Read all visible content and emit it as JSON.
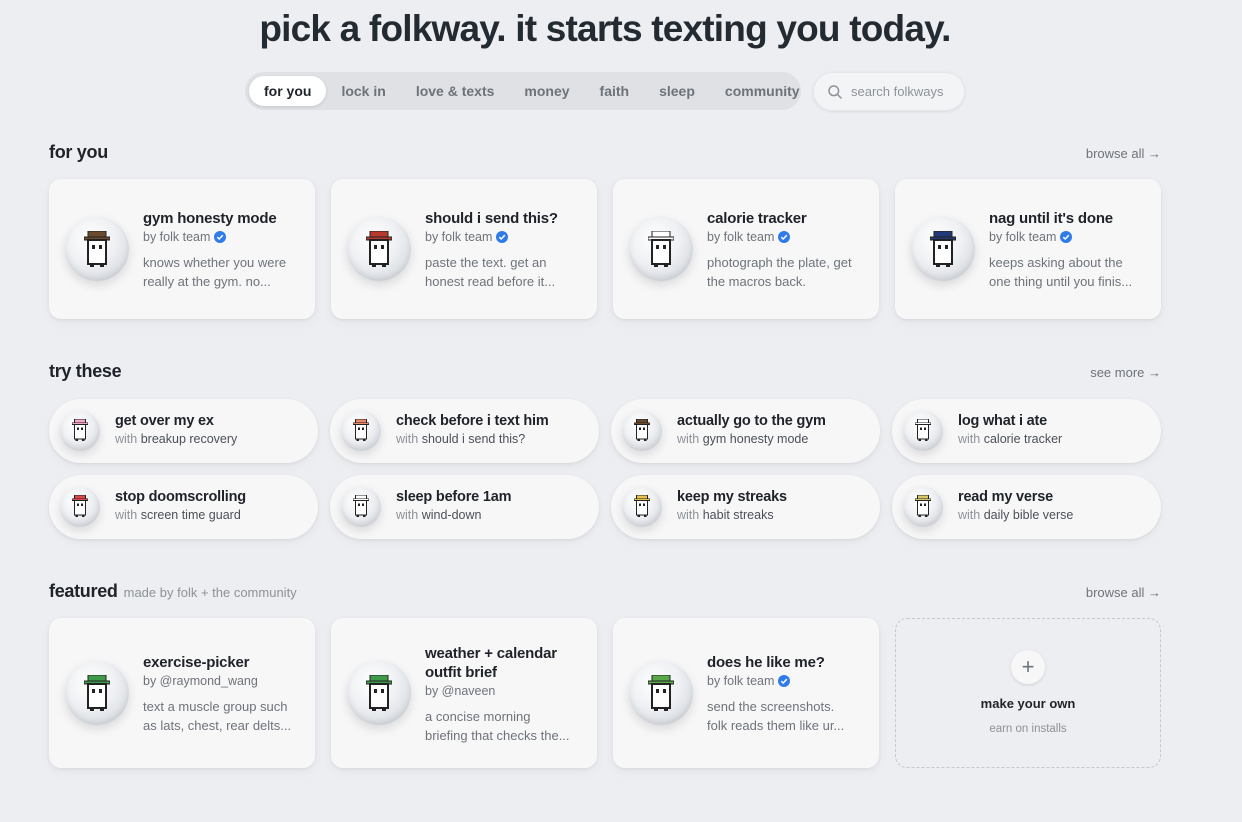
{
  "hero": {
    "title": "pick a folkway. it starts texting you today."
  },
  "tabs": [
    {
      "label": "for you",
      "active": true
    },
    {
      "label": "lock in"
    },
    {
      "label": "love & texts"
    },
    {
      "label": "money"
    },
    {
      "label": "faith"
    },
    {
      "label": "sleep"
    },
    {
      "label": "community"
    }
  ],
  "search": {
    "placeholder": "search folkways",
    "icon": "search-icon"
  },
  "sections": {
    "for_you": {
      "title": "for you",
      "link": "browse all →",
      "cards": [
        {
          "title": "gym honesty mode",
          "author": "by folk team",
          "verified": true,
          "desc1": "knows whether you were",
          "desc2": "really at the gym. no...",
          "hat": "#6b4a2f"
        },
        {
          "title": "should i send this?",
          "author": "by folk team",
          "verified": true,
          "desc1": "paste the text. get an",
          "desc2": "honest read before it...",
          "hat": "#b83a2e"
        },
        {
          "title": "calorie tracker",
          "author": "by folk team",
          "verified": true,
          "desc1": "photograph the plate, get",
          "desc2": "the macros back.",
          "hat": "#ffffff"
        },
        {
          "title": "nag until it's done",
          "author": "by folk team",
          "verified": true,
          "desc1": "keeps asking about the",
          "desc2": "one thing until you finis...",
          "hat": "#233a7a"
        }
      ]
    },
    "try_these": {
      "title": "try these",
      "link": "see more →",
      "with_prefix": "with",
      "pills": [
        {
          "title": "get over my ex",
          "with": "breakup recovery",
          "color": "#f2a6c8"
        },
        {
          "title": "check before i text him",
          "with": "should i send this?",
          "color": "#e88a6a"
        },
        {
          "title": "actually go to the gym",
          "with": "gym honesty mode",
          "color": "#6b4a2f"
        },
        {
          "title": "log what i ate",
          "with": "calorie tracker",
          "color": "#ffffff"
        },
        {
          "title": "stop doomscrolling",
          "with": "screen time guard",
          "color": "#d94a4a"
        },
        {
          "title": "sleep before 1am",
          "with": "wind-down",
          "color": "#ffffff"
        },
        {
          "title": "keep my streaks",
          "with": "habit streaks",
          "color": "#e8c24a"
        },
        {
          "title": "read my verse",
          "with": "daily bible verse",
          "color": "#d9c86a"
        }
      ]
    },
    "featured": {
      "title": "featured",
      "subtitle": "made by folk + the community",
      "link": "browse all →",
      "cards": [
        {
          "title": "exercise-picker",
          "author": "by @raymond_wang",
          "verified": false,
          "desc1": "text a muscle group such",
          "desc2": "as lats, chest, rear delts...",
          "hat": "#3f9a4a"
        },
        {
          "title": "weather + calendar outfit brief",
          "author": "by @naveen",
          "verified": false,
          "desc1": "a concise morning",
          "desc2": "briefing that checks the...",
          "hat": "#3f9a4a"
        },
        {
          "title": "does he like me?",
          "author": "by folk team",
          "verified": true,
          "desc1": "send the screenshots.",
          "desc2": "folk reads them like ur...",
          "hat": "#5aa84a"
        }
      ],
      "make_own": {
        "plus": "+",
        "title": "make your own",
        "subtitle": "earn on installs"
      }
    }
  },
  "colors": {
    "background": "#eceef1",
    "verified": "#2f7be8"
  }
}
